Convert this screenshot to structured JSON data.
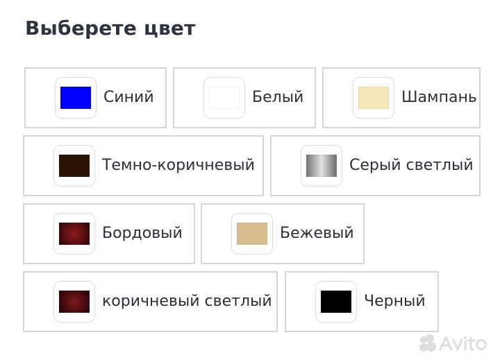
{
  "header": {
    "title": "Выберете цвет"
  },
  "colors": {
    "blue": "#0000ff",
    "white": "#ffffff",
    "champagne": "#f4e7b7",
    "dark_brown": "#2a1406",
    "light_grey": "#a8a8a8",
    "bordo": "#6a1115",
    "beige": "#d9bd8e",
    "light_brown": "#4f0e12",
    "black": "#000000"
  },
  "options": [
    {
      "label": "Синий"
    },
    {
      "label": "Белый"
    },
    {
      "label": "Шампань"
    },
    {
      "label": "Темно-коричневый"
    },
    {
      "label": "Серый светлый"
    },
    {
      "label": "Бордовый"
    },
    {
      "label": "Бежевый"
    },
    {
      "label": "коричневый светлый"
    },
    {
      "label": "Черный"
    }
  ],
  "watermark": {
    "text": "Avito",
    "icon": "avito-logo-icon"
  }
}
